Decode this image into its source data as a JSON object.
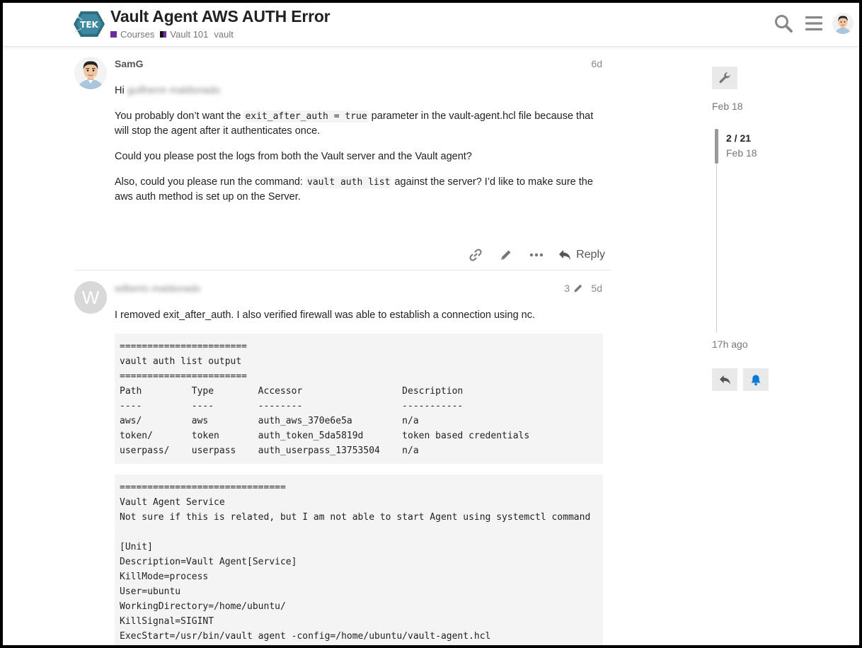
{
  "header": {
    "title": "Vault Agent AWS AUTH Error",
    "categories": [
      {
        "label": "Courses",
        "color": "#6c2aa3"
      },
      {
        "label": "Vault 101",
        "color": "#111111"
      }
    ],
    "tag": "vault"
  },
  "posts": [
    {
      "username": "SamG",
      "date": "6d",
      "greeting": "Hi",
      "greeting_name": "guilherm maldonado",
      "p1_before": "You probably don’t want the ",
      "p1_code": "exit_after_auth = true",
      "p1_after": " parameter in the vault-agent.hcl file because that will stop the agent after it authenticates once.",
      "p2": "Could you please post the logs from both the Vault server and the Vault agent?",
      "p3_before": "Also, could you please run the command: ",
      "p3_code": "vault auth list",
      "p3_after": " against the server? I’d like to make sure the aws auth method is set up on the Server.",
      "reply_label": "Reply"
    },
    {
      "avatar_letter": "W",
      "username": "wilberto maldonado",
      "edit_count": "3",
      "date": "5d",
      "intro": "I removed exit_after_auth. I also verified firewall was able to establish a connection using nc.",
      "code1": "=======================\nvault auth list output\n=======================\nPath         Type        Accessor                  Description\n----         ----        --------                  -----------\naws/         aws         auth_aws_370e6e5a         n/a\ntoken/       token       auth_token_5da5819d       token based credentials\nuserpass/    userpass    auth_userpass_13753504    n/a",
      "code2": "==============================\nVault Agent Service\nNot sure if this is related, but I am not able to start Agent using systemctl command\n\n[Unit]\nDescription=Vault Agent[Service]\nKillMode=process\nUser=ubuntu\nWorkingDirectory=/home/ubuntu/\nKillSignal=SIGINT\nExecStart=/usr/bin/vault agent -config=/home/ubuntu/vault-agent.hcl"
    }
  ],
  "timeline": {
    "start_date": "Feb 18",
    "position": "2 / 21",
    "position_date": "Feb 18",
    "end_date": "17h ago"
  },
  "colors": {
    "accent_bell": "#0a7ad6",
    "code_bg": "#f4f4f4"
  }
}
